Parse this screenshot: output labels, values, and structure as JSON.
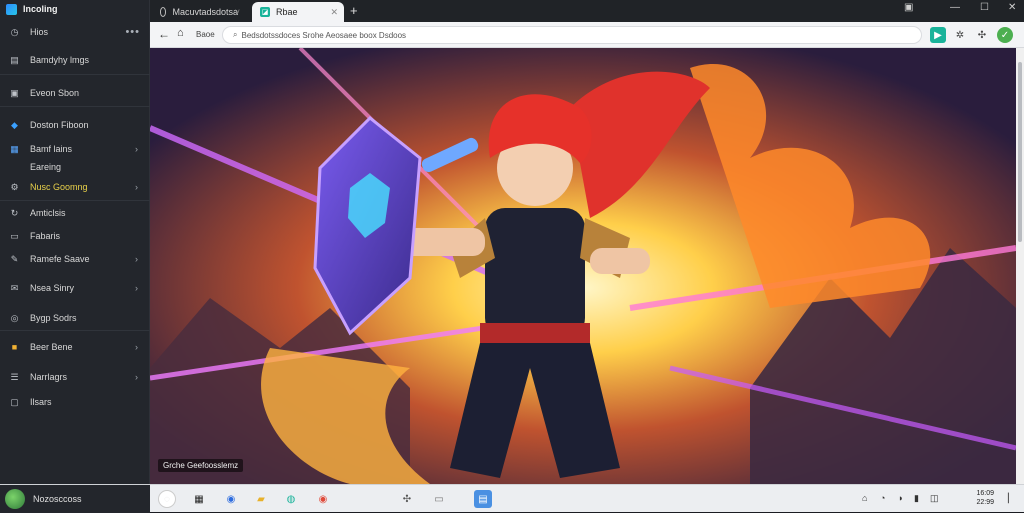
{
  "sidebar": {
    "app_title": "Incoling",
    "items": [
      {
        "label": "Hios",
        "icon": "clock-icon"
      },
      {
        "label": "Bamdyhy lmgs",
        "icon": "document-icon"
      },
      {
        "label": "Eveon Sbon",
        "icon": "gallery-icon"
      },
      {
        "label": "Doston Fiboon",
        "icon": "drive-icon"
      },
      {
        "label": "Bamf lains",
        "icon": "image-icon"
      },
      {
        "label": "Eareing",
        "icon": ""
      },
      {
        "label": "Nusc Goomng",
        "icon": "settings-icon"
      },
      {
        "label": "Amticlsis",
        "icon": "refresh-icon"
      },
      {
        "label": "Fabaris",
        "icon": "folder-icon"
      },
      {
        "label": "Ramefe Saave",
        "icon": "edit-icon"
      },
      {
        "label": "Nsea Sinry",
        "icon": "mail-icon"
      },
      {
        "label": "Bygp Sodrs",
        "icon": "gamepad-icon"
      },
      {
        "label": "Beer Bene",
        "icon": "star-folder-icon"
      },
      {
        "label": "Narrlagrs",
        "icon": "list-icon"
      },
      {
        "label": "Ilsars",
        "icon": "note-icon"
      }
    ]
  },
  "browser": {
    "tabs": [
      {
        "label": "Macuvtadsdotsa"
      },
      {
        "label": "Rbae"
      }
    ],
    "nav_label": "Baoe",
    "address": "Bedsdotssdoces Srohe Aeosaee boox Dsdoos"
  },
  "content": {
    "caption": "Grche Geefoosslemz"
  },
  "taskbar": {
    "user": "Nozosccoss",
    "clock_time": "16:09",
    "clock_date": "22:99"
  },
  "colors": {
    "accent": "#19b39a",
    "sidebar_bg": "#23262c",
    "highlight": "#e8d04a"
  }
}
